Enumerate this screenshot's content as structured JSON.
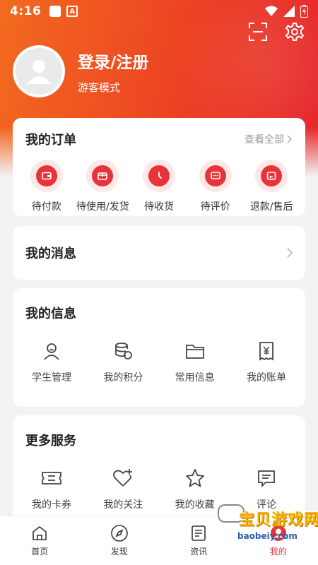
{
  "status_bar": {
    "time": "4:16",
    "a_icon": "A"
  },
  "profile": {
    "login": "登录/注册",
    "mode": "游客模式"
  },
  "orders": {
    "title": "我的订单",
    "view_all": "查看全部",
    "items": [
      {
        "label": "待付款",
        "icon": "wallet-icon"
      },
      {
        "label": "待使用/发货",
        "icon": "box-icon"
      },
      {
        "label": "待收货",
        "icon": "clock-icon"
      },
      {
        "label": "待评价",
        "icon": "comment-icon"
      },
      {
        "label": "退款/售后",
        "icon": "return-icon"
      }
    ]
  },
  "messages": {
    "title": "我的消息"
  },
  "info": {
    "title": "我的信息",
    "items": [
      {
        "label": "学生管理",
        "icon": "student-icon"
      },
      {
        "label": "我的积分",
        "icon": "coins-icon"
      },
      {
        "label": "常用信息",
        "icon": "folder-icon"
      },
      {
        "label": "我的账单",
        "icon": "bill-icon"
      }
    ]
  },
  "more": {
    "title": "更多服务",
    "items": [
      {
        "label": "我的卡券",
        "icon": "ticket-icon"
      },
      {
        "label": "我的关注",
        "icon": "heart-plus-icon"
      },
      {
        "label": "我的收藏",
        "icon": "star-icon"
      },
      {
        "label": "评论",
        "icon": "review-icon"
      }
    ]
  },
  "tabbar": {
    "items": [
      {
        "label": "首页",
        "icon": "home-icon"
      },
      {
        "label": "发现",
        "icon": "compass-icon"
      },
      {
        "label": "资讯",
        "icon": "news-icon"
      },
      {
        "label": "我的",
        "icon": "user-icon"
      }
    ]
  },
  "watermark": {
    "text": "宝贝游戏网",
    "url": "baobeiy.com"
  },
  "colors": {
    "accent": "#e7343b",
    "header_start": "#f26a1f",
    "header_end": "#e5232a"
  }
}
